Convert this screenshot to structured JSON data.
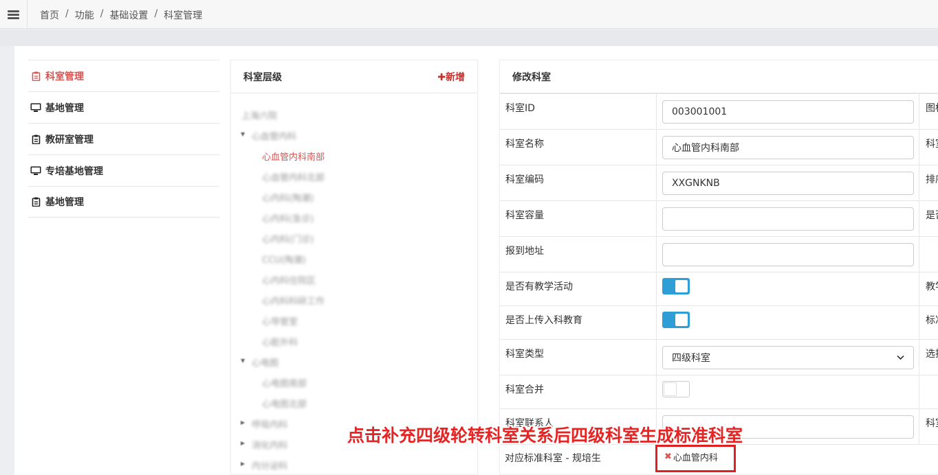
{
  "breadcrumb": [
    "首页",
    "功能",
    "基础设置",
    "科室管理"
  ],
  "nav": [
    {
      "label": "科室管理",
      "icon": "clipboard-icon",
      "active": true
    },
    {
      "label": "基地管理",
      "icon": "monitor-icon",
      "active": false
    },
    {
      "label": "教研室管理",
      "icon": "clipboard-icon",
      "active": false
    },
    {
      "label": "专培基地管理",
      "icon": "monitor-icon",
      "active": false
    },
    {
      "label": "基地管理",
      "icon": "clipboard-icon",
      "active": false
    }
  ],
  "tree_panel": {
    "title": "科室层级",
    "add_label": "✚新增",
    "nodes": [
      {
        "label": "上海六院",
        "level": 0
      },
      {
        "label": "心血管内科",
        "level": 1,
        "expanded": true
      },
      {
        "label": "心血管内科南部",
        "level": 2,
        "selected": true
      },
      {
        "label": "心血管内科北部",
        "level": 2
      },
      {
        "label": "心内科(陶潮)",
        "level": 2
      },
      {
        "label": "心内科(急诊)",
        "level": 2
      },
      {
        "label": "心内科(门诊)",
        "level": 2
      },
      {
        "label": "CCU(陶潮)",
        "level": 2
      },
      {
        "label": "心内科住院区",
        "level": 2
      },
      {
        "label": "心内科科研工作",
        "level": 2
      },
      {
        "label": "心导管室",
        "level": 2
      },
      {
        "label": "心脏外科",
        "level": 2
      },
      {
        "label": "心电图",
        "level": 1,
        "expanded": true
      },
      {
        "label": "心电图南部",
        "level": 2
      },
      {
        "label": "心电图北部",
        "level": 2
      },
      {
        "label": "呼吸内科",
        "level": 1,
        "expanded": false
      },
      {
        "label": "消化内科",
        "level": 1,
        "expanded": false
      },
      {
        "label": "内分泌科",
        "level": 1,
        "expanded": false
      }
    ]
  },
  "form_panel": {
    "title": "修改科室",
    "rows": [
      {
        "label": "科室ID",
        "type": "input",
        "value": "003001001",
        "right_label": "图标"
      },
      {
        "label": "科室名称",
        "type": "input",
        "value": "心血管内科南部",
        "right_label": "科室"
      },
      {
        "label": "科室编码",
        "type": "input",
        "value": "XXGNKNB",
        "right_label": "排序"
      },
      {
        "label": "科室容量",
        "type": "input",
        "value": "",
        "right_label": "是否"
      },
      {
        "label": "报到地址",
        "type": "input",
        "value": "",
        "right_label": ""
      },
      {
        "label": "是否有教学活动",
        "type": "toggle",
        "on": true,
        "right_label": "教学"
      },
      {
        "label": "是否上传入科教育",
        "type": "toggle",
        "on": true,
        "right_label": "标准"
      },
      {
        "label": "科室类型",
        "type": "select",
        "value": "四级科室",
        "right_label": "选择"
      },
      {
        "label": "科室合并",
        "type": "toggle",
        "on": false,
        "right_label": ""
      },
      {
        "label": "科室联系人",
        "type": "input",
        "value": "",
        "right_label": "科室"
      }
    ],
    "standard_label": "对应标准科室 - 规培生",
    "standard_tag": "心血管内科",
    "standard_tag_remove": "✖"
  },
  "annotation": "点击补充四级轮转科室关系后四级科室生成标准科室",
  "colors": {
    "accent_red": "#d9534f",
    "toggle_blue": "#2f9ed7",
    "annotation_red": "#e52424"
  }
}
